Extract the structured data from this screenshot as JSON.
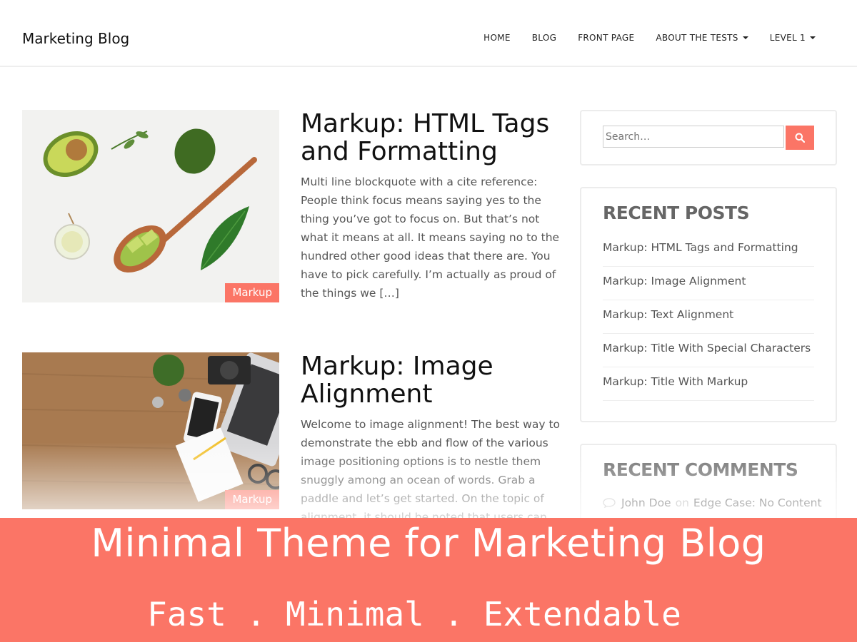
{
  "header": {
    "brand": "Marketing Blog",
    "nav": [
      {
        "label": "HOME",
        "dropdown": false
      },
      {
        "label": "BLOG",
        "dropdown": false
      },
      {
        "label": "FRONT PAGE",
        "dropdown": false
      },
      {
        "label": "ABOUT THE TESTS",
        "dropdown": true
      },
      {
        "label": "LEVEL 1",
        "dropdown": true
      }
    ]
  },
  "posts": [
    {
      "title": "Markup: HTML Tags and Formatting",
      "excerpt": "Multi line blockquote with a cite reference: People think focus means saying yes to the thing you’ve got to focus on. But that’s not what it means at all. It means saying no to the hundred other good ideas that there are. You have to pick carefully. I’m actually as proud of the things we […]",
      "category": "Markup"
    },
    {
      "title": "Markup: Image Alignment",
      "excerpt": "Welcome to image alignment! The best way to demonstrate the ebb and flow of the various image positioning options is to nestle them snuggly among an ocean of words. Grab a paddle and let’s get started. On the topic of alignment, it should be noted that users can choose from the",
      "category": "Markup"
    }
  ],
  "sidebar": {
    "search": {
      "placeholder": "Search…"
    },
    "recent_posts": {
      "title": "RECENT POSTS",
      "items": [
        "Markup: HTML Tags and Formatting",
        "Markup: Image Alignment",
        "Markup: Text Alignment",
        "Markup: Title With Special Characters",
        "Markup: Title With Markup"
      ]
    },
    "recent_comments": {
      "title": "RECENT COMMENTS",
      "items": [
        {
          "author": "John Doe",
          "on": "on",
          "post": "Edge Case: No Content"
        }
      ]
    }
  },
  "banner": {
    "title": "Minimal Theme for Marketing Blog",
    "subtitle": "Fast . Minimal . Extendable"
  },
  "colors": {
    "accent": "#fb7566",
    "text": "#555555",
    "heading": "#111111"
  }
}
